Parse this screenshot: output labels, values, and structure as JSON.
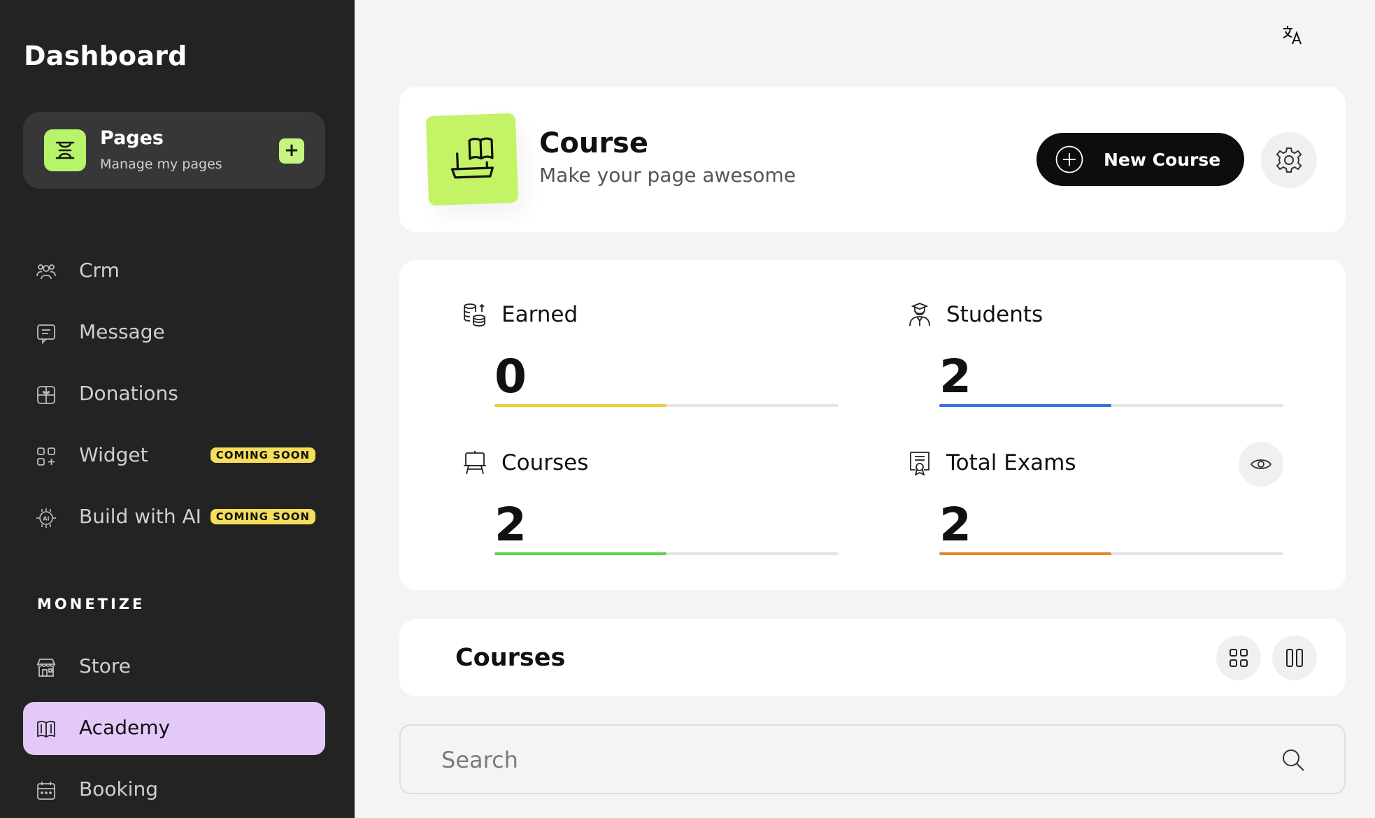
{
  "sidebar": {
    "title": "Dashboard",
    "pages_card": {
      "title": "Pages",
      "subtitle": "Manage my pages",
      "add_label": "+"
    },
    "items": [
      {
        "label": "Crm",
        "icon": "users-icon"
      },
      {
        "label": "Message",
        "icon": "message-icon"
      },
      {
        "label": "Donations",
        "icon": "gift-icon"
      },
      {
        "label": "Widget",
        "icon": "widget-icon",
        "badge": "COMING SOON"
      },
      {
        "label": "Build with AI",
        "icon": "ai-chip-icon",
        "badge": "COMING SOON"
      }
    ],
    "section_title": "MONETIZE",
    "monetize_items": [
      {
        "label": "Store",
        "icon": "store-icon"
      },
      {
        "label": "Academy",
        "icon": "academy-icon",
        "active": true
      },
      {
        "label": "Booking",
        "icon": "calendar-icon"
      }
    ]
  },
  "header": {
    "title": "Course",
    "subtitle": "Make your page awesome",
    "new_course_label": "New Course"
  },
  "stats": [
    {
      "label": "Earned",
      "value": "0",
      "color": "#e8d23a",
      "progress": 0.5,
      "icon": "coins-icon"
    },
    {
      "label": "Students",
      "value": "2",
      "color": "#3b6fe0",
      "progress": 0.5,
      "icon": "student-icon"
    },
    {
      "label": "Courses",
      "value": "2",
      "color": "#5fd34d",
      "progress": 0.5,
      "icon": "easel-icon"
    },
    {
      "label": "Total Exams",
      "value": "2",
      "color": "#e08a2e",
      "progress": 0.5,
      "icon": "certificate-icon"
    }
  ],
  "courses_section": {
    "title": "Courses"
  },
  "search": {
    "placeholder": "Search"
  },
  "colors": {
    "sidebar_bg": "#232323",
    "accent_green": "#c4f365",
    "active_purple": "#e2c9f9",
    "badge_yellow": "#f6de5a"
  }
}
